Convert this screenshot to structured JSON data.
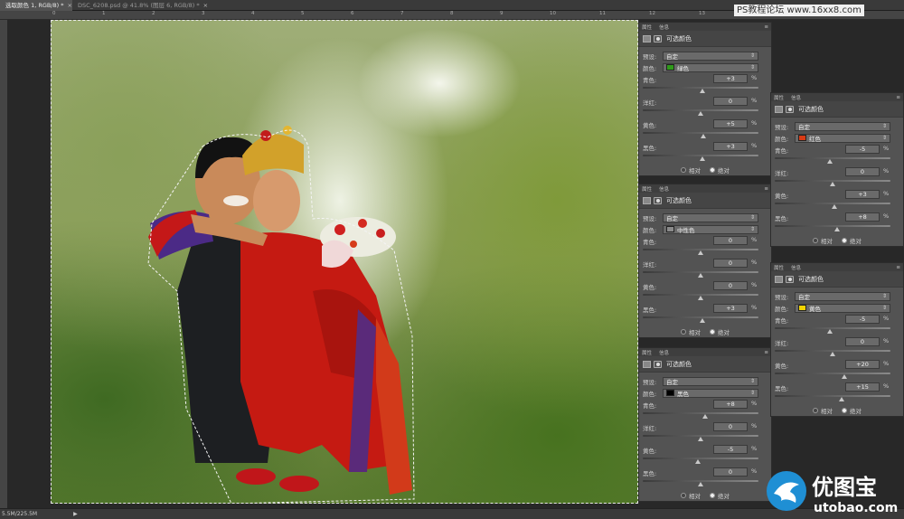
{
  "tabs": [
    {
      "label": "选取颜色 1, RGB/8) *",
      "active": true
    },
    {
      "label": "DSC_6208.psd @ 41.8% (图层 6, RGB/8) *",
      "active": false
    }
  ],
  "ruler_ticks": [
    "0",
    "1",
    "2",
    "3",
    "4",
    "5",
    "6",
    "7",
    "8",
    "9",
    "10",
    "11",
    "12",
    "13"
  ],
  "watermark": "PS教程论坛 www.16xx8.com",
  "panels": [
    {
      "tabs": [
        "属性",
        "信息"
      ],
      "title": "可选颜色",
      "preset_label": "预设:",
      "preset_value": "自定",
      "color_label": "颜色:",
      "color_value": "绿色",
      "swatch": "#2f9a1a",
      "sliders": [
        {
          "label": "青色:",
          "value": "+3",
          "fraction": 0.515
        },
        {
          "label": "洋红:",
          "value": "0",
          "fraction": 0.5
        },
        {
          "label": "黄色:",
          "value": "+5",
          "fraction": 0.525
        },
        {
          "label": "黑色:",
          "value": "+3",
          "fraction": 0.515
        }
      ],
      "radio_rel": "相对",
      "radio_abs": "绝对"
    },
    {
      "tabs": [
        "属性",
        "信息"
      ],
      "title": "可选颜色",
      "preset_label": "预设:",
      "preset_value": "自定",
      "color_label": "颜色:",
      "color_value": "中性色",
      "swatch": "#8a8a8a",
      "sliders": [
        {
          "label": "青色:",
          "value": "0",
          "fraction": 0.5
        },
        {
          "label": "洋红:",
          "value": "0",
          "fraction": 0.5
        },
        {
          "label": "黄色:",
          "value": "0",
          "fraction": 0.5
        },
        {
          "label": "黑色:",
          "value": "+3",
          "fraction": 0.515
        }
      ],
      "radio_rel": "相对",
      "radio_abs": "绝对"
    },
    {
      "tabs": [
        "属性",
        "信息"
      ],
      "title": "可选颜色",
      "preset_label": "预设:",
      "preset_value": "自定",
      "color_label": "颜色:",
      "color_value": "黑色",
      "swatch": "#000000",
      "sliders": [
        {
          "label": "青色:",
          "value": "+8",
          "fraction": 0.54
        },
        {
          "label": "洋红:",
          "value": "0",
          "fraction": 0.5
        },
        {
          "label": "黄色:",
          "value": "-5",
          "fraction": 0.475
        },
        {
          "label": "黑色:",
          "value": "0",
          "fraction": 0.5
        }
      ],
      "radio_rel": "相对",
      "radio_abs": "绝对"
    },
    {
      "tabs": [
        "属性",
        "信息"
      ],
      "title": "可选颜色",
      "preset_label": "预设:",
      "preset_value": "自定",
      "color_label": "颜色:",
      "color_value": "红色",
      "swatch": "#d83a14",
      "sliders": [
        {
          "label": "青色:",
          "value": "-5",
          "fraction": 0.475
        },
        {
          "label": "洋红:",
          "value": "0",
          "fraction": 0.5
        },
        {
          "label": "黄色:",
          "value": "+3",
          "fraction": 0.515
        },
        {
          "label": "黑色:",
          "value": "+8",
          "fraction": 0.54
        }
      ],
      "radio_rel": "相对",
      "radio_abs": "绝对"
    },
    {
      "tabs": [
        "属性",
        "信息"
      ],
      "title": "可选颜色",
      "preset_label": "预设:",
      "preset_value": "自定",
      "color_label": "颜色:",
      "color_value": "黄色",
      "swatch": "#f2d400",
      "sliders": [
        {
          "label": "青色:",
          "value": "-5",
          "fraction": 0.475
        },
        {
          "label": "洋红:",
          "value": "0",
          "fraction": 0.5
        },
        {
          "label": "黄色:",
          "value": "+20",
          "fraction": 0.6
        },
        {
          "label": "黑色:",
          "value": "+15",
          "fraction": 0.575
        }
      ],
      "radio_rel": "相对",
      "radio_abs": "绝对"
    }
  ],
  "status": {
    "doc_size": "5.5M/225.5M"
  },
  "logo": {
    "brand": "优图宝",
    "url": "utobao.com"
  }
}
